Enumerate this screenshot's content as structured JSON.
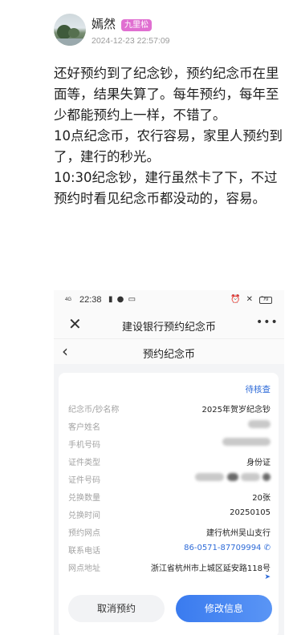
{
  "post": {
    "username": "嫣然",
    "badge": "九里松",
    "timestamp": "2024-12-23 22:57:09",
    "paragraphs": [
      "还好预约到了纪念钞，预约纪念币在里面等，结果失算了。每年预约，每年至少都能预约上一样，不错了。",
      "10点纪念币，农行容易，家里人预约到了，建行的秒光。",
      "10:30纪念钞，建行虽然卡了下，不过预约时看见纪念币都没动的，容易。"
    ]
  },
  "screenshot": {
    "status_bar": {
      "network": "4G",
      "time": "22:38",
      "left_icons": "▮ ● ▭",
      "right_icons": "⏰ ✕ ◠",
      "battery": "79"
    },
    "titlebar": {
      "close_glyph": "✕",
      "title": "建设银行预约纪念币",
      "more_glyph": "•••"
    },
    "navbar": {
      "back_glyph": "‹",
      "title": "预约纪念币"
    },
    "card": {
      "status": "待核查",
      "fields": [
        {
          "label": "纪念币/钞名称",
          "value": "2025年贺岁纪念钞"
        },
        {
          "label": "客户姓名",
          "value": ""
        },
        {
          "label": "手机号码",
          "value": ""
        },
        {
          "label": "证件类型",
          "value": "身份证"
        },
        {
          "label": "证件号码",
          "value": ""
        },
        {
          "label": "兑换数量",
          "value": "20张"
        },
        {
          "label": "兑换时间",
          "value": "20250105"
        },
        {
          "label": "预约网点",
          "value": "建行杭州吴山支行"
        },
        {
          "label": "联系电话",
          "value": "86-0571-87709994"
        },
        {
          "label": "网点地址",
          "value": "浙江省杭州市上城区延安路118号"
        }
      ]
    },
    "buttons": {
      "cancel": "取消预约",
      "edit": "修改信息"
    },
    "colors": {
      "accent": "#2e6bd8",
      "badge": "#e06fd1"
    }
  }
}
